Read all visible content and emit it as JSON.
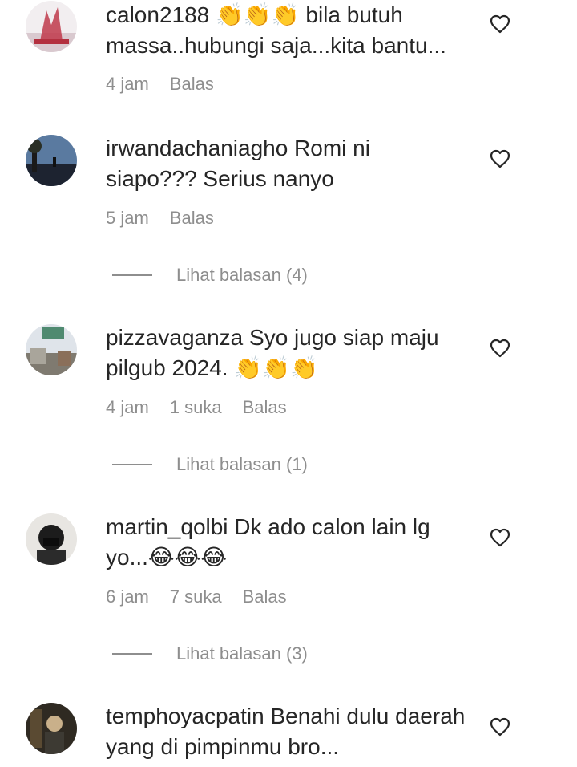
{
  "comments": [
    {
      "username": "calon2188",
      "text": " 👏👏👏 bila butuh massa..hubungi saja...kita bantu...",
      "time": "4 jam",
      "likes": "",
      "reply": "Balas",
      "view_replies": ""
    },
    {
      "username": "irwandachaniagho",
      "text": " Romi ni siapo??? Serius nanyo",
      "time": "5 jam",
      "likes": "",
      "reply": "Balas",
      "view_replies": "Lihat balasan (4)"
    },
    {
      "username": "pizzavaganza",
      "text": " Syo jugo siap maju pilgub 2024. 👏👏👏",
      "time": "4 jam",
      "likes": "1 suka",
      "reply": "Balas",
      "view_replies": "Lihat balasan (1)"
    },
    {
      "username": "martin_qolbi",
      "text": " Dk ado calon lain lg yo...😂😂😂",
      "time": "6 jam",
      "likes": "7 suka",
      "reply": "Balas",
      "view_replies": "Lihat balasan (3)"
    },
    {
      "username": "temphoyacpatin",
      "text": " Benahi dulu daerah yang di pimpinmu bro...",
      "time": "",
      "likes": "",
      "reply": "",
      "view_replies": ""
    }
  ],
  "icons": {
    "like": "heart-outline-icon"
  }
}
